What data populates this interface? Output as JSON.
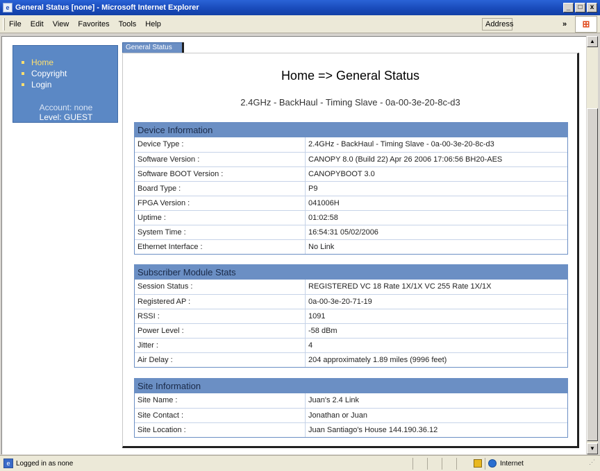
{
  "window": {
    "title": "General Status [none] - Microsoft Internet Explorer",
    "minimize": "_",
    "maximize": "□",
    "close": "x"
  },
  "menu": {
    "items": [
      "File",
      "Edit",
      "View",
      "Favorites",
      "Tools",
      "Help"
    ],
    "address_label": "Address",
    "chevron": "»"
  },
  "nav": {
    "links": [
      "Home",
      "Copyright",
      "Login"
    ],
    "account": "Account: none",
    "level": "Level: GUEST"
  },
  "tab": {
    "label": "General Status"
  },
  "page": {
    "title": "Home => General Status",
    "subtitle": "2.4GHz - BackHaul - Timing Slave - 0a-00-3e-20-8c-d3"
  },
  "device_info": {
    "header": "Device Information",
    "rows": [
      {
        "label": "Device Type :",
        "value": "2.4GHz - BackHaul - Timing Slave - 0a-00-3e-20-8c-d3"
      },
      {
        "label": "Software Version :",
        "value": "CANOPY 8.0 (Build 22) Apr 26 2006 17:06:56 BH20-AES"
      },
      {
        "label": "Software BOOT Version :",
        "value": "CANOPYBOOT 3.0"
      },
      {
        "label": "Board Type :",
        "value": "P9"
      },
      {
        "label": "FPGA Version :",
        "value": "041006H"
      },
      {
        "label": "Uptime :",
        "value": "01:02:58"
      },
      {
        "label": "System Time :",
        "value": "16:54:31 05/02/2006"
      },
      {
        "label": "Ethernet Interface :",
        "value": "No Link"
      }
    ]
  },
  "sm_stats": {
    "header": "Subscriber Module Stats",
    "rows": [
      {
        "label": "Session Status :",
        "value": "REGISTERED VC 18 Rate 1X/1X VC 255 Rate 1X/1X"
      },
      {
        "label": "Registered AP :",
        "value": "0a-00-3e-20-71-19"
      },
      {
        "label": "RSSI :",
        "value": "1091"
      },
      {
        "label": "Power Level :",
        "value": "-58 dBm"
      },
      {
        "label": "Jitter :",
        "value": "4"
      },
      {
        "label": "Air Delay :",
        "value": "204 approximately 1.89 miles (9996 feet)"
      }
    ]
  },
  "site_info": {
    "header": "Site Information",
    "rows": [
      {
        "label": "Site Name :",
        "value": "Juan's 2.4 Link"
      },
      {
        "label": "Site Contact :",
        "value": "Jonathan or Juan"
      },
      {
        "label": "Site Location :",
        "value": "Juan Santiago's House 144.190.36.12"
      }
    ]
  },
  "status": {
    "text": "Logged in as none",
    "zone": "Internet"
  },
  "colors": {
    "section_header": "#6b8fc4",
    "nav_background": "#5b88c5",
    "nav_link_active": "#ffe070"
  }
}
